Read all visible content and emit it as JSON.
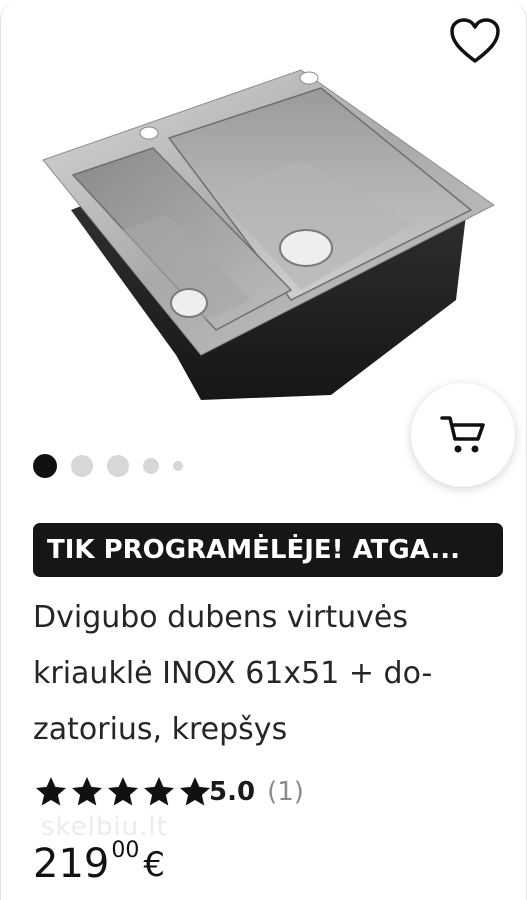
{
  "listing": {
    "promo_badge": "TIK PROGRAMĖLĖJE! ATGA...",
    "title_lines": [
      "Dvigubo dubens virtuvės",
      "kriauklė INOX 61x51 + do-",
      "zatorius, krepšys"
    ],
    "rating": {
      "stars": 5,
      "value": "5.0",
      "count": "(1)"
    },
    "price": {
      "integer": "219",
      "decimal": "00",
      "currency": "€"
    },
    "watermark": "skelbiu.lt"
  },
  "carousel": {
    "image_count": 5,
    "active_index": 0
  },
  "icons": {
    "favorite": "heart-outline-icon",
    "cart": "shopping-cart-icon",
    "star": "star-filled-icon"
  },
  "colors": {
    "badge_bg": "#161616",
    "badge_text": "#ffffff",
    "dot_active": "#111111",
    "dot_inactive": "#d7d7d7",
    "rating_count": "#8c8c8c"
  }
}
